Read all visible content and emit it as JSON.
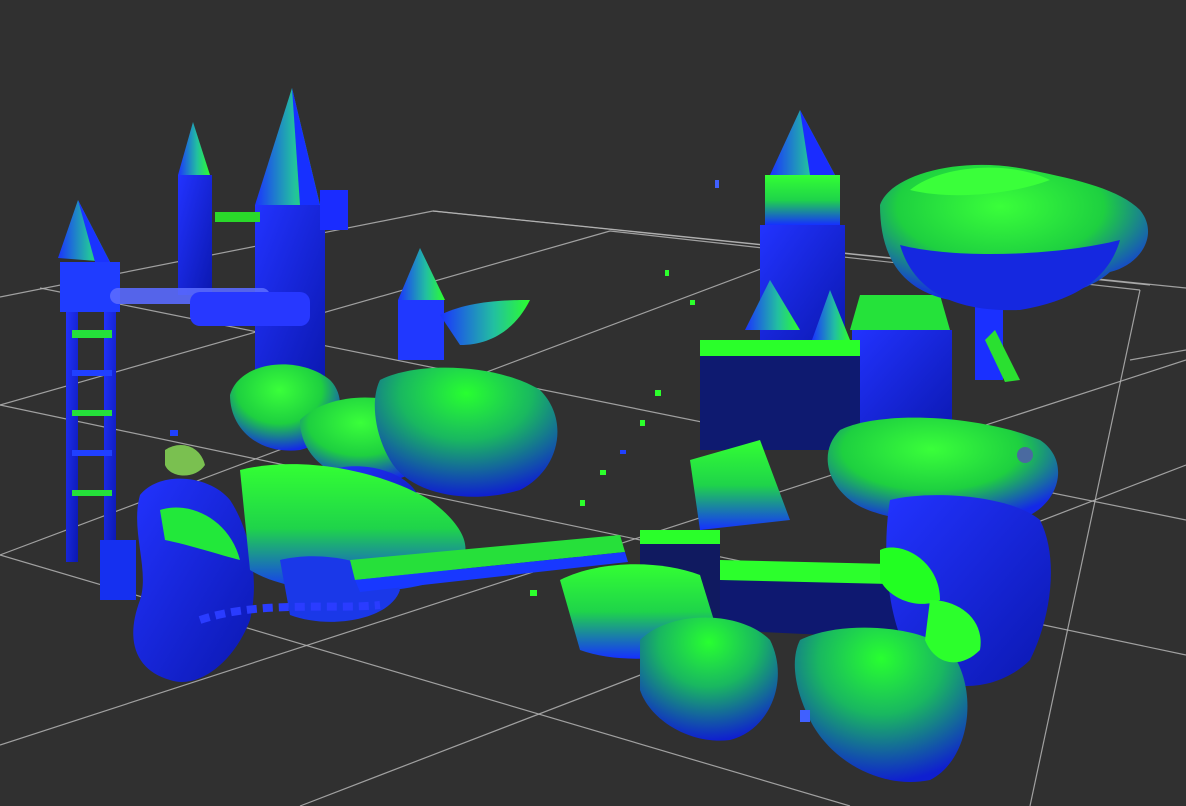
{
  "viewport": {
    "background": "#303030",
    "grid_color": "#b4b4b4",
    "mesh_palette": {
      "normal_up": "#22ff22",
      "normal_side": "#1a33ff",
      "normal_mix": "#2a7fff",
      "shadow": "#0a14a0",
      "accent": "#7a3dff"
    }
  },
  "scene": {
    "objects": [
      "castle-tower-left",
      "castle-keep-left",
      "rock-island-left",
      "chain-bridge",
      "castle-tower-right",
      "castle-fortress-right",
      "floating-island-right",
      "mushroom-tree"
    ]
  }
}
